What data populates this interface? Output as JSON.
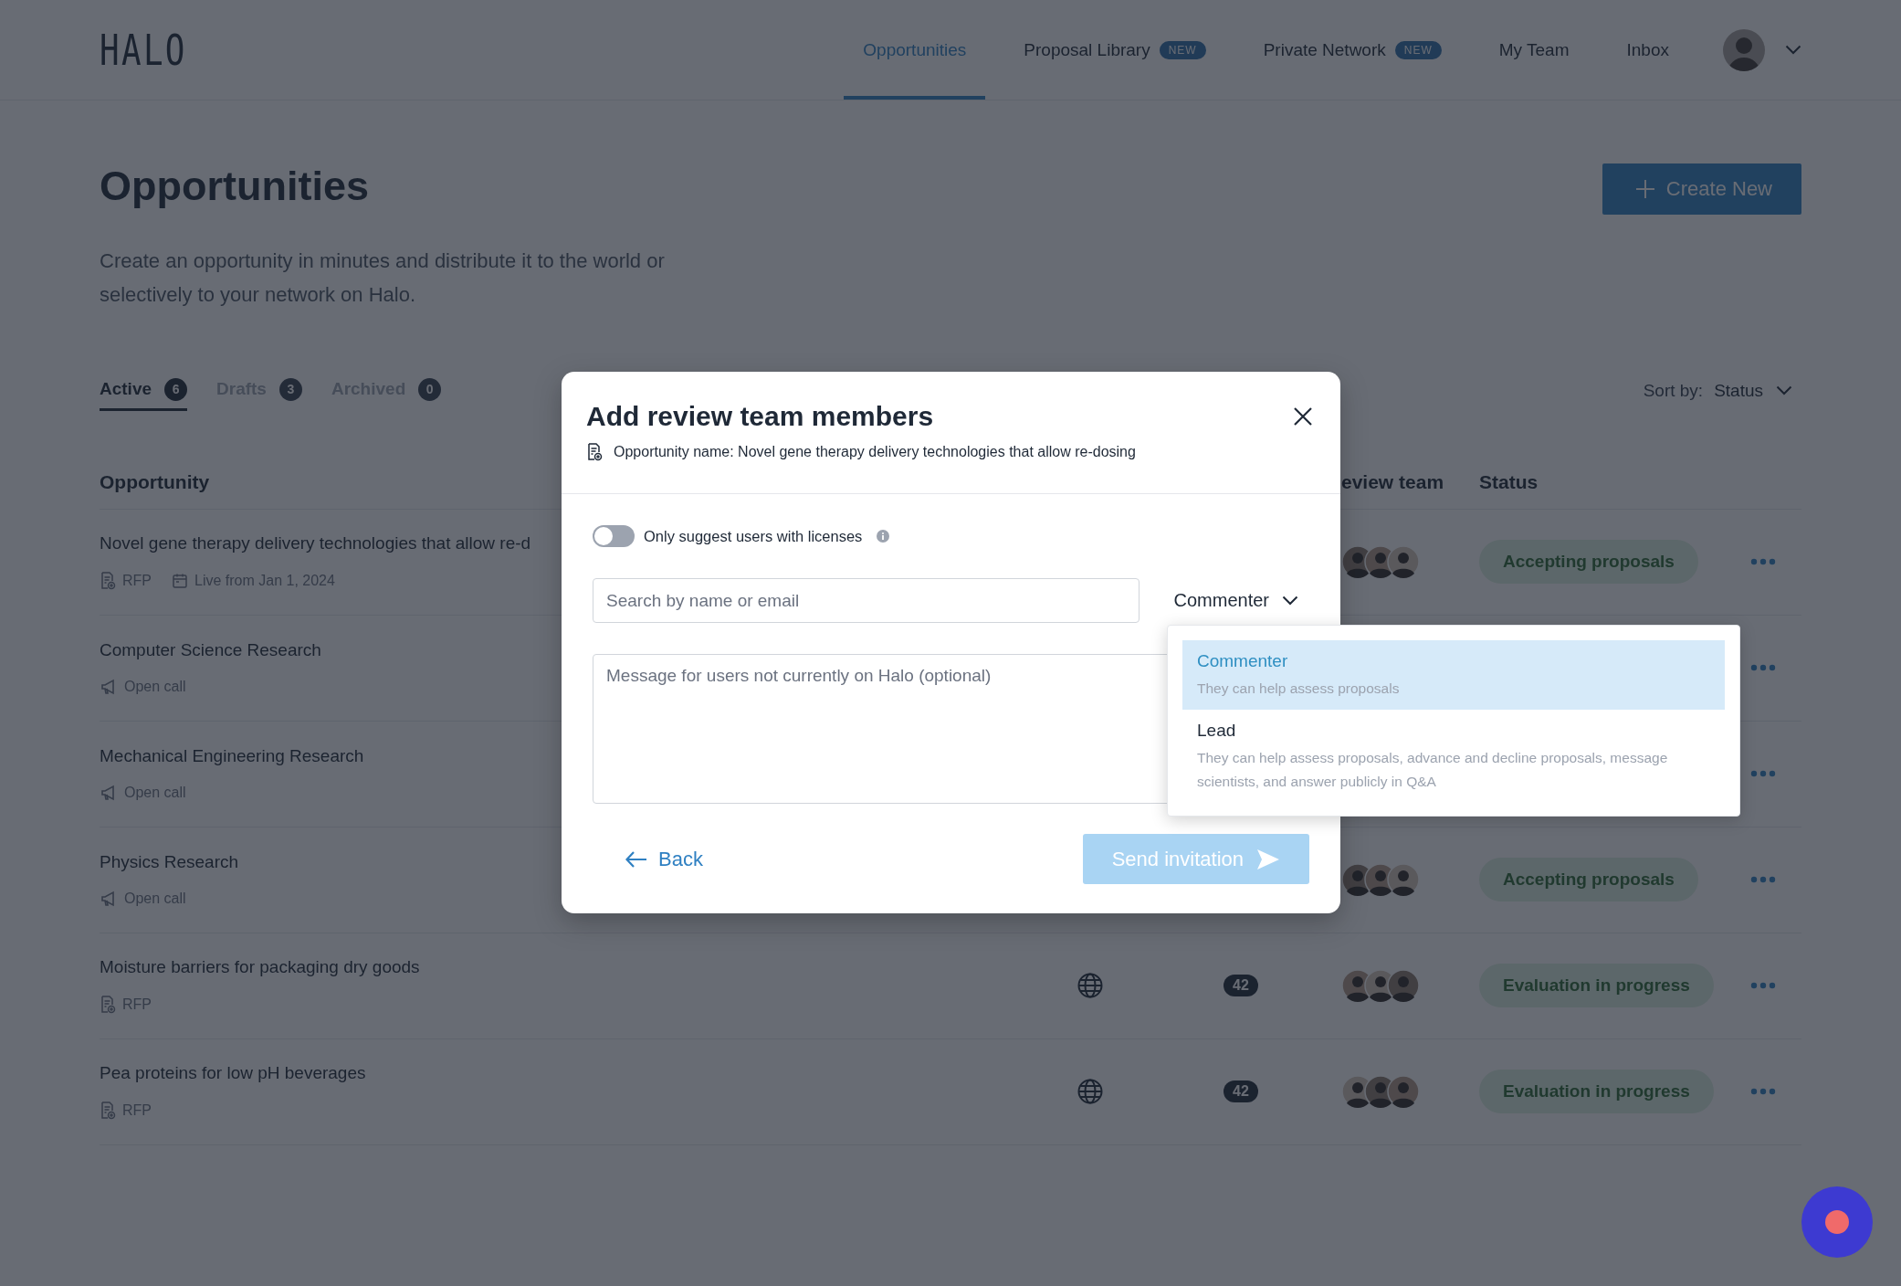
{
  "header": {
    "logo": "HALO",
    "nav": [
      {
        "label": "Opportunities",
        "selected": true
      },
      {
        "label": "Proposal Library",
        "badge": "NEW",
        "selected": false
      },
      {
        "label": "Private Network",
        "badge": "NEW",
        "selected": false
      },
      {
        "label": "My Team",
        "selected": false
      },
      {
        "label": "Inbox",
        "selected": false
      }
    ]
  },
  "page": {
    "title": "Opportunities",
    "description": "Create an opportunity in minutes and distribute it to the world or selectively to your network on Halo.",
    "create_button": "Create New"
  },
  "tabs": [
    {
      "label": "Active",
      "count": "6",
      "selected": true
    },
    {
      "label": "Drafts",
      "count": "3",
      "selected": false
    },
    {
      "label": "Archived",
      "count": "0",
      "selected": false
    }
  ],
  "sort": {
    "label": "Sort by:",
    "value": "Status"
  },
  "table": {
    "columns": [
      "Opportunity",
      "eview team",
      "Status"
    ],
    "rows": [
      {
        "title": "Novel gene therapy delivery technologies that allow re-d",
        "meta": [
          {
            "kind": "rfp",
            "label": "RFP"
          },
          {
            "kind": "date",
            "label": "Live from Jan 1, 2024"
          }
        ],
        "reviewers": [
          {
            "kind": "avatar"
          },
          {
            "kind": "avatar"
          },
          {
            "kind": "avatar"
          }
        ],
        "status": "Accepting proposals"
      },
      {
        "title": "Computer Science Research",
        "meta": [
          {
            "kind": "open_call",
            "label": "Open call"
          }
        ]
      },
      {
        "title": "Mechanical Engineering Research",
        "meta": [
          {
            "kind": "open_call",
            "label": "Open call"
          }
        ]
      },
      {
        "title": "Physics Research",
        "meta": [
          {
            "kind": "open_call",
            "label": "Open call"
          }
        ],
        "reviewers": [
          {
            "kind": "avatar"
          },
          {
            "kind": "avatar"
          },
          {
            "kind": "avatar"
          }
        ],
        "status": "Accepting proposals"
      },
      {
        "title": "Moisture barriers for packaging dry goods",
        "meta": [
          {
            "kind": "rfp",
            "label": "RFP"
          }
        ],
        "public": true,
        "count": "42",
        "reviewers": [
          {
            "kind": "avatar"
          },
          {
            "kind": "avatar"
          },
          {
            "kind": "avatar"
          }
        ],
        "status": "Evaluation in progress"
      },
      {
        "title": "Pea proteins for low pH beverages",
        "meta": [
          {
            "kind": "rfp",
            "label": "RFP"
          }
        ],
        "public": true,
        "count": "42",
        "reviewers": [
          {
            "kind": "avatar"
          },
          {
            "kind": "avatar"
          },
          {
            "kind": "avatar"
          }
        ],
        "status": "Evaluation in progress"
      }
    ]
  },
  "modal": {
    "title": "Add review team members",
    "subtitle": "Opportunity name: Novel gene therapy delivery technologies that allow re-dosing",
    "license_toggle": {
      "label": "Only suggest users with licenses",
      "on": false
    },
    "search": {
      "placeholder": "Search by name or email"
    },
    "role_select": {
      "value": "Commenter",
      "expanded": true,
      "options": [
        {
          "label": "Commenter",
          "description": "They can help assess proposals",
          "selected": true
        },
        {
          "label": "Lead",
          "description": "They can help assess proposals, advance and decline proposals, message scientists, and answer publicly in Q&A",
          "selected": false
        }
      ]
    },
    "message": {
      "placeholder": "Message for users not currently on Halo (optional)"
    },
    "back_button": "Back",
    "send_button": {
      "label": "Send invitation",
      "disabled": true
    }
  }
}
